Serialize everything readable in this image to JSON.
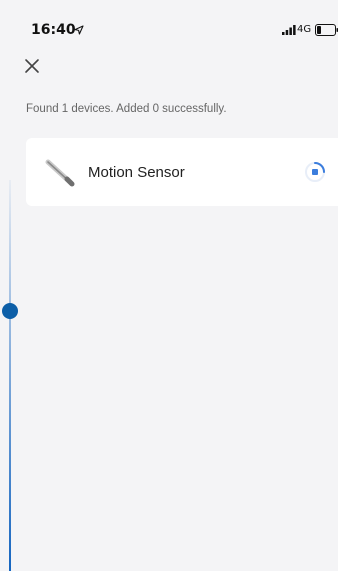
{
  "status_bar": {
    "time": "16:40",
    "network": "4G",
    "icons": [
      "location-arrow-icon",
      "signal-icon",
      "battery-icon"
    ]
  },
  "header": {
    "close_icon": "close-icon"
  },
  "scan": {
    "summary": "Found 1 devices. Added 0 successfully."
  },
  "devices": [
    {
      "name": "Motion Sensor",
      "icon": "motion-sensor-icon",
      "status_icon": "loading-spinner-icon"
    }
  ],
  "colors": {
    "background": "#f4f4f6",
    "card": "#ffffff",
    "accent": "#3b7ddd",
    "timeline": "#0d5fa8"
  }
}
